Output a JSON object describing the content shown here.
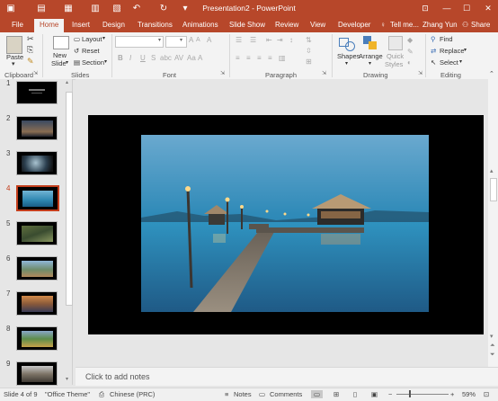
{
  "window": {
    "title": "Presentation2 - PowerPoint"
  },
  "tabs": [
    "File",
    "Home",
    "Insert",
    "Design",
    "Transitions",
    "Animations",
    "Slide Show",
    "Review",
    "View",
    "Developer"
  ],
  "tell_me": "Tell me...",
  "user": "Zhang Yun",
  "share": "Share",
  "ribbon": {
    "clipboard": {
      "paste": "Paste",
      "label": "Clipboard"
    },
    "slides": {
      "new_slide": "New",
      "new_slide2": "Slide",
      "layout": "Layout",
      "reset": "Reset",
      "section": "Section",
      "label": "Slides"
    },
    "font": {
      "label": "Font"
    },
    "paragraph": {
      "label": "Paragraph"
    },
    "drawing": {
      "shapes": "Shapes",
      "arrange": "Arrange",
      "quick_styles": "Quick",
      "quick_styles2": "Styles",
      "label": "Drawing"
    },
    "editing": {
      "find": "Find",
      "replace": "Replace",
      "select": "Select",
      "label": "Editing"
    }
  },
  "thumbnails": [
    "1",
    "2",
    "3",
    "4",
    "5",
    "6",
    "7",
    "8",
    "9"
  ],
  "selected_slide": 4,
  "notes_placeholder": "Click to add notes",
  "status": {
    "slide": "Slide 4 of 9",
    "theme": "\"Office Theme\"",
    "language": "Chinese (PRC)",
    "notes": "Notes",
    "comments": "Comments",
    "zoom": "59%"
  },
  "colors": {
    "accent": "#b7472a",
    "selected_border": "#c43e1c"
  }
}
